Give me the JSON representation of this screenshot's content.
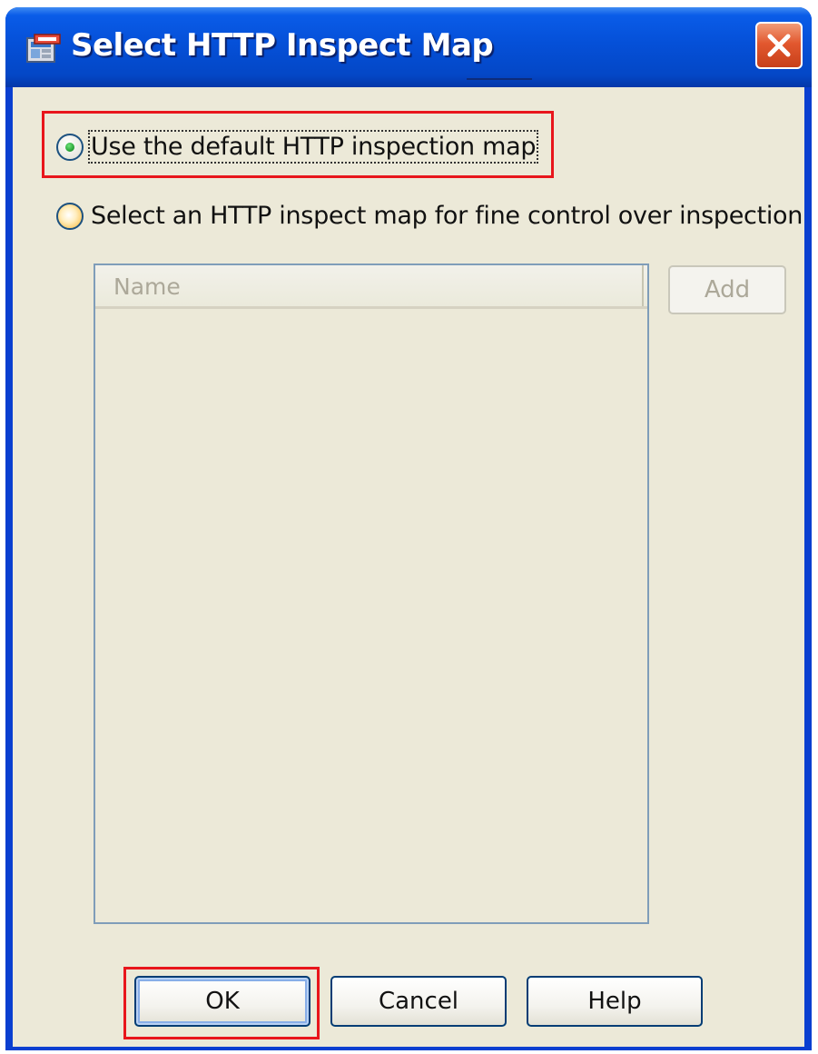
{
  "window": {
    "title": "Select HTTP Inspect Map",
    "app_icon": "asdm-window-icon",
    "close_icon": "close-icon"
  },
  "options": {
    "default_map": {
      "label": "Use the default HTTP inspection map",
      "selected": true
    },
    "custom_map": {
      "label": "Select an HTTP inspect map for fine control over inspection",
      "selected": false
    }
  },
  "map_list": {
    "columns": [
      "Name"
    ],
    "rows": []
  },
  "buttons": {
    "add": "Add",
    "ok": "OK",
    "cancel": "Cancel",
    "help": "Help"
  },
  "colors": {
    "titlebar": "#0550d8",
    "client_bg": "#ece9d8",
    "highlight_box": "#e8161c",
    "close_button": "#e2582f"
  }
}
